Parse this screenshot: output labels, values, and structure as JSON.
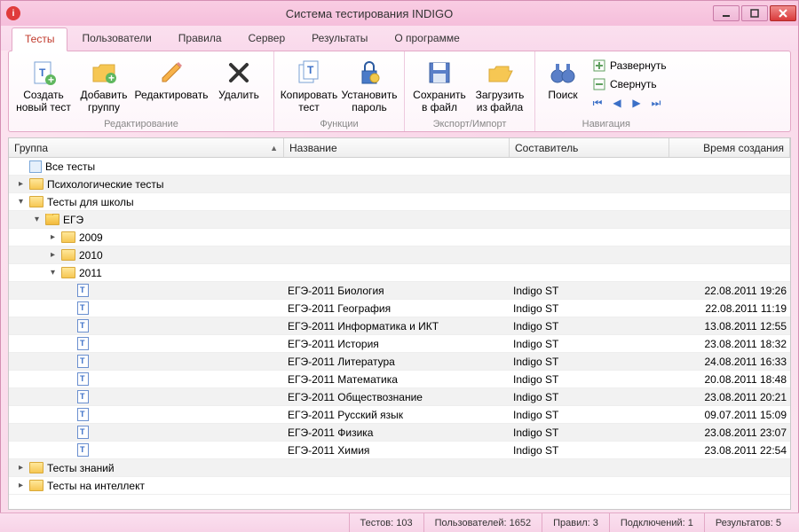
{
  "window": {
    "title": "Система тестирования INDIGO"
  },
  "tabs": [
    "Тесты",
    "Пользователи",
    "Правила",
    "Сервер",
    "Результаты",
    "О программе"
  ],
  "ribbon": {
    "group_edit": {
      "label": "Редактирование",
      "new_test": "Создать\nновый тест",
      "add_group": "Добавить\nгруппу",
      "edit": "Редактировать",
      "delete": "Удалить"
    },
    "group_func": {
      "label": "Функции",
      "copy_test": "Копировать\nтест",
      "set_pass": "Установить\nпароль"
    },
    "group_io": {
      "label": "Экспорт/Импорт",
      "save_file": "Сохранить\nв файл",
      "load_file": "Загрузить\nиз файла"
    },
    "group_nav": {
      "label": "Навигация",
      "search": "Поиск",
      "expand": "Развернуть",
      "collapse": "Свернуть"
    }
  },
  "columns": {
    "group": "Группа",
    "name": "Название",
    "author": "Составитель",
    "date": "Время создания"
  },
  "tree": {
    "root": "Все тесты",
    "psych": "Психологические тесты",
    "school": "Тесты для школы",
    "ege": "ЕГЭ",
    "y2009": "2009",
    "y2010": "2010",
    "y2011": "2011",
    "knowledge": "Тесты знаний",
    "intellect": "Тесты на интеллект"
  },
  "tests": [
    {
      "name": "ЕГЭ-2011 Биология",
      "author": "Indigo ST",
      "date": "22.08.2011 19:26"
    },
    {
      "name": "ЕГЭ-2011 География",
      "author": "Indigo ST",
      "date": "22.08.2011 11:19"
    },
    {
      "name": "ЕГЭ-2011 Информатика и ИКТ",
      "author": "Indigo ST",
      "date": "13.08.2011 12:55"
    },
    {
      "name": "ЕГЭ-2011 История",
      "author": "Indigo ST",
      "date": "23.08.2011 18:32"
    },
    {
      "name": "ЕГЭ-2011 Литература",
      "author": "Indigo ST",
      "date": "24.08.2011 16:33"
    },
    {
      "name": "ЕГЭ-2011 Математика",
      "author": "Indigo ST",
      "date": "20.08.2011 18:48"
    },
    {
      "name": "ЕГЭ-2011 Обществознание",
      "author": "Indigo ST",
      "date": "23.08.2011 20:21"
    },
    {
      "name": "ЕГЭ-2011 Русский язык",
      "author": "Indigo ST",
      "date": "09.07.2011 15:09"
    },
    {
      "name": "ЕГЭ-2011 Физика",
      "author": "Indigo ST",
      "date": "23.08.2011 23:07"
    },
    {
      "name": "ЕГЭ-2011 Химия",
      "author": "Indigo ST",
      "date": "23.08.2011 22:54"
    }
  ],
  "status": {
    "tests": "Тестов: 103",
    "users": "Пользователей: 1652",
    "rules": "Правил: 3",
    "conns": "Подключений: 1",
    "results": "Результатов: 5"
  }
}
